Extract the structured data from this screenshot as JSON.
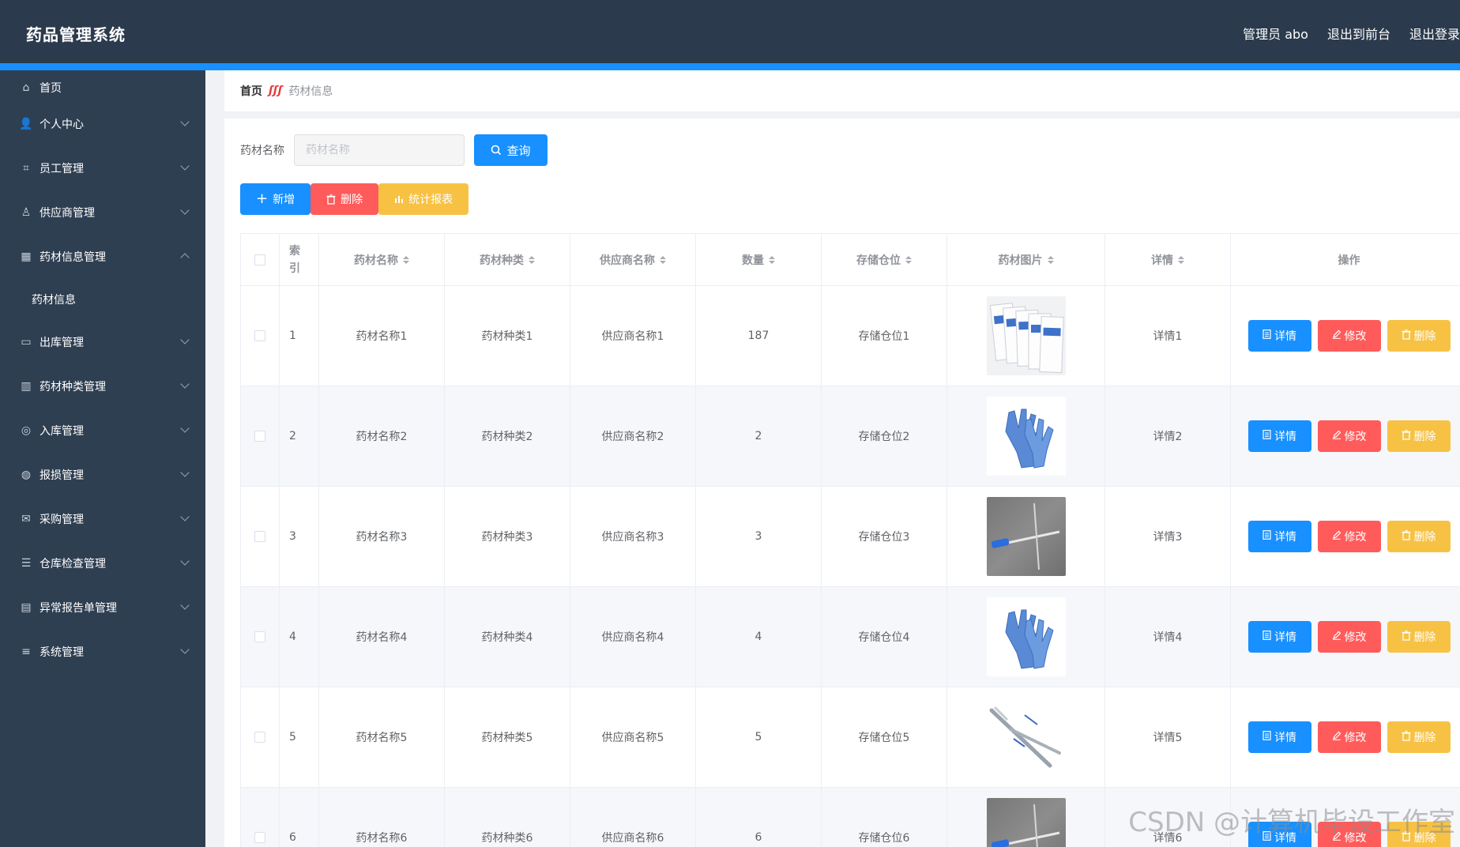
{
  "header": {
    "brand": "药品管理系统",
    "admin": "管理员 abo",
    "front": "退出到前台",
    "logout": "退出登录"
  },
  "sidebar": {
    "items": [
      {
        "label": "首页",
        "icon": "home-icon",
        "chevron": "none"
      },
      {
        "label": "个人中心",
        "icon": "user-icon",
        "chevron": "down"
      },
      {
        "label": "员工管理",
        "icon": "crop-icon",
        "chevron": "down"
      },
      {
        "label": "供应商管理",
        "icon": "person-icon",
        "chevron": "down"
      },
      {
        "label": "药材信息管理",
        "icon": "grid-icon",
        "chevron": "up"
      },
      {
        "label": "出库管理",
        "icon": "monitor-icon",
        "chevron": "down"
      },
      {
        "label": "药材种类管理",
        "icon": "books-icon",
        "chevron": "down"
      },
      {
        "label": "入库管理",
        "icon": "compass-icon",
        "chevron": "down"
      },
      {
        "label": "报损管理",
        "icon": "globe-icon",
        "chevron": "down"
      },
      {
        "label": "采购管理",
        "icon": "mail-icon",
        "chevron": "down"
      },
      {
        "label": "仓库检查管理",
        "icon": "sliders-icon",
        "chevron": "down"
      },
      {
        "label": "异常报告单管理",
        "icon": "briefcase-icon",
        "chevron": "down"
      },
      {
        "label": "系统管理",
        "icon": "menu-icon",
        "chevron": "down"
      }
    ],
    "submenu": "药材信息"
  },
  "breadcrumb": {
    "home": "首页",
    "current": "药材信息"
  },
  "search": {
    "label": "药材名称",
    "placeholder": "药材名称",
    "query": "查询"
  },
  "toolbar": {
    "add": "新增",
    "delete": "删除",
    "stats": "统计报表"
  },
  "table": {
    "headers": {
      "index_top": "索",
      "index_bottom": "引",
      "name": "药材名称",
      "kind": "药材种类",
      "supplier": "供应商名称",
      "qty": "数量",
      "location": "存储仓位",
      "image": "药材图片",
      "detail": "详情",
      "ops": "操作"
    },
    "rows": [
      {
        "index": "1",
        "name": "药材名称1",
        "kind": "药材种类1",
        "supplier": "供应商名称1",
        "qty": "187",
        "location": "存储仓位1",
        "image": "bags",
        "detail": "详情1"
      },
      {
        "index": "2",
        "name": "药材名称2",
        "kind": "药材种类2",
        "supplier": "供应商名称2",
        "qty": "2",
        "location": "存储仓位2",
        "image": "gloves",
        "detail": "详情2"
      },
      {
        "index": "3",
        "name": "药材名称3",
        "kind": "药材种类3",
        "supplier": "供应商名称3",
        "qty": "3",
        "location": "存储仓位3",
        "image": "pen",
        "detail": "详情3"
      },
      {
        "index": "4",
        "name": "药材名称4",
        "kind": "药材种类4",
        "supplier": "供应商名称4",
        "qty": "4",
        "location": "存储仓位4",
        "image": "gloves",
        "detail": "详情4"
      },
      {
        "index": "5",
        "name": "药材名称5",
        "kind": "药材种类5",
        "supplier": "供应商名称5",
        "qty": "5",
        "location": "存储仓位5",
        "image": "scalpel",
        "detail": "详情5"
      },
      {
        "index": "6",
        "name": "药材名称6",
        "kind": "药材种类6",
        "supplier": "供应商名称6",
        "qty": "6",
        "location": "存储仓位6",
        "image": "pen",
        "detail": "详情6"
      }
    ],
    "op_detail": "详情",
    "op_edit": "修改",
    "op_delete": "删除"
  },
  "watermark": "CSDN @计算机毕设工作室",
  "colors": {
    "header_bg": "#2b3a4d",
    "sidebar_bg": "#2f3f52",
    "primary": "#1890ff",
    "danger": "#ff5b5b",
    "warning": "#f7c244"
  }
}
